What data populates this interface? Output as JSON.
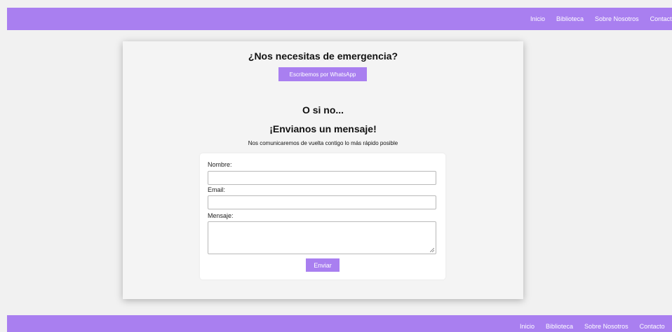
{
  "nav": {
    "items": [
      "Inicio",
      "Biblioteca",
      "Sobre Nosotros",
      "Contacto"
    ]
  },
  "main": {
    "heading_emergency": "¿Nos necesitas de emergencia?",
    "whatsapp_button": "Escribemos por WhatsApp",
    "heading_or": "O si no...",
    "heading_send": "¡Envianos un mensaje!",
    "subtitle": "Nos comunicaremos de vuelta contigo lo más rápido posible"
  },
  "form": {
    "name_label": "Nombre:",
    "name_value": "",
    "email_label": "Email:",
    "email_value": "",
    "message_label": "Mensaje:",
    "message_value": "",
    "submit_label": "Enviar"
  },
  "footer": {
    "items": [
      "Inicio",
      "Biblioteca",
      "Sobre Nosotros",
      "Contacto"
    ]
  },
  "colors": {
    "accent": "#a97ff0",
    "background": "#f1f1f1",
    "card": "#f4f4f4"
  }
}
